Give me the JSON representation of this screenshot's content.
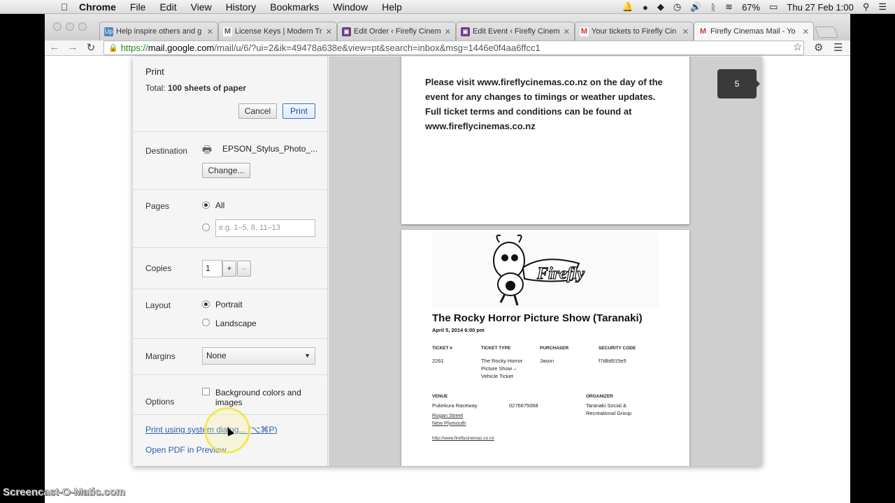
{
  "menubar": {
    "app": "Chrome",
    "items": [
      "File",
      "Edit",
      "View",
      "History",
      "Bookmarks",
      "Window",
      "Help"
    ],
    "battery": "67%",
    "clock": "Thu 27 Feb  1:00"
  },
  "tabs": [
    {
      "title": "Help inspire others and g",
      "favicon": "up"
    },
    {
      "title": "License Keys | Modern Tr",
      "favicon": "mm"
    },
    {
      "title": "Edit Order ‹ Firefly Cinem",
      "favicon": "wp"
    },
    {
      "title": "Edit Event ‹ Firefly Cinem",
      "favicon": "wp"
    },
    {
      "title": "Your tickets to Firefly Cin",
      "favicon": "gm"
    },
    {
      "title": "Firefly Cinemas Mail - Yo",
      "favicon": "gm"
    }
  ],
  "address": {
    "scheme": "https://",
    "host": "mail.google.com",
    "path": "/mail/u/6/?ui=2&ik=49478a638e&view=pt&search=inbox&msg=1446e0f4aa6ffcc1"
  },
  "print": {
    "title": "Print",
    "total_label": "Total:",
    "total_value": "100 sheets of paper",
    "cancel": "Cancel",
    "print": "Print",
    "destination_label": "Destination",
    "destination_value": "EPSON_Stylus_Photo_...",
    "change": "Change...",
    "pages_label": "Pages",
    "pages_all": "All",
    "pages_placeholder": "e.g. 1–5, 8, 11–13",
    "copies_label": "Copies",
    "copies_value": "1",
    "plus": "+",
    "minus": "–",
    "layout_label": "Layout",
    "portrait": "Portrait",
    "landscape": "Landscape",
    "margins_label": "Margins",
    "margins_value": "None",
    "options_label": "Options",
    "bg_option": "Background colors and images",
    "system_dialog": "Print using system dialog... (⌥⌘P)",
    "open_pdf": "Open PDF in Preview"
  },
  "preview": {
    "page_number": "5",
    "notice": "Please visit www.fireflycinemas.co.nz on the day of the event for any changes to timings or weather updates. Full ticket terms and conditions can be found at www.fireflycinemas.co.nz",
    "show_title": "The Rocky Horror Picture Show (Taranaki)",
    "show_date": "April 5, 2014 6:00 pm",
    "headers": {
      "ticket_no": "TICKET #",
      "ticket_type": "TICKET TYPE",
      "purchaser": "PURCHASER",
      "security": "SECURITY CODE",
      "venue": "VENUE",
      "organizer": "ORGANIZER"
    },
    "values": {
      "ticket_no": "2261",
      "ticket_type": "The Rocky Horror Picture Show – Vehicle Ticket",
      "purchaser": "Jason",
      "security": "f7d8d915e5",
      "venue_name": "Pukekura Raceway",
      "venue_phone": "0276675068",
      "venue_street": "Rogan Street",
      "venue_city": "New Plymouth",
      "organizer": "Taranaki Social & Recreational Group",
      "url": "http://www.fireflycinemas.co.nz"
    }
  },
  "watermark": "Screencast-O-Matic.com",
  "colors": {
    "link": "#2a5cb0",
    "primary_border": "#3d72c6",
    "badge": "#3a3a3a"
  }
}
